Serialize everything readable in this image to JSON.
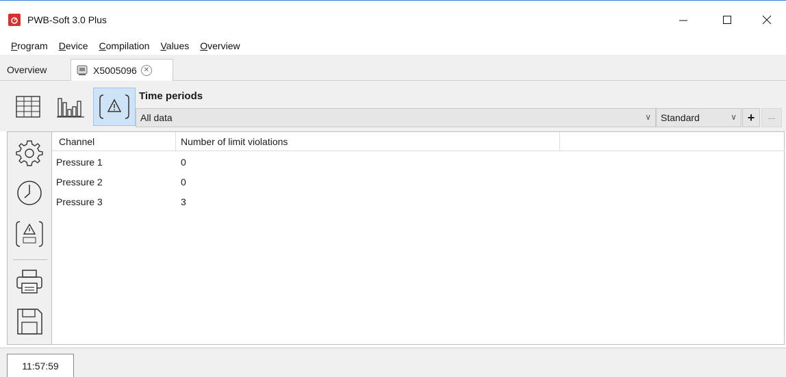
{
  "window": {
    "title": "PWB-Soft 3.0 Plus"
  },
  "menu": [
    "Program",
    "Device",
    "Compilation",
    "Values",
    "Overview"
  ],
  "menu_mnemonic": [
    "P",
    "D",
    "C",
    "V",
    "O"
  ],
  "tabs": {
    "overview": "Overview",
    "device": "X5005096"
  },
  "toolbar": {
    "time_periods_label": "Time periods",
    "time_period_value": "All data",
    "profile_value": "Standard",
    "add_label": "+",
    "remove_label": "–"
  },
  "table": {
    "headers": [
      "Channel",
      "Number of limit violations"
    ],
    "rows": [
      {
        "channel": "Pressure 1",
        "violations": "0"
      },
      {
        "channel": "Pressure 2",
        "violations": "0"
      },
      {
        "channel": "Pressure 3",
        "violations": "3"
      }
    ]
  },
  "sidebar_icons": [
    "gear-icon",
    "clock-icon",
    "limit-time-icon",
    "printer-icon",
    "save-icon"
  ],
  "status": {
    "time": "11:57:59"
  },
  "colors": {
    "accent": "#d9302c",
    "selected": "#cfe3f7"
  }
}
